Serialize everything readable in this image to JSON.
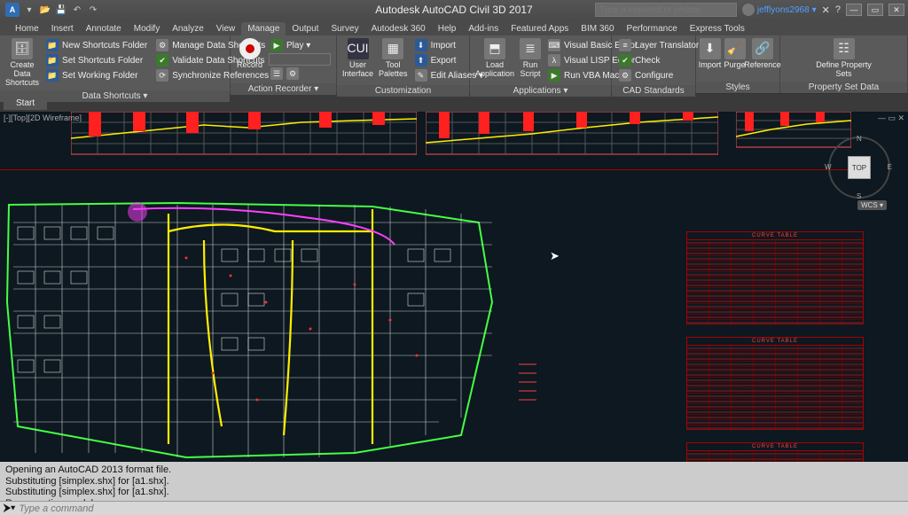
{
  "app_title": "Autodesk AutoCAD Civil 3D 2017",
  "search_placeholder": "Type a keyword or phrase",
  "user": "jefflyons2968",
  "ribbon_tabs": [
    "Home",
    "Insert",
    "Annotate",
    "Modify",
    "Analyze",
    "View",
    "Manage",
    "Output",
    "Survey",
    "Autodesk 360",
    "Help",
    "Add-ins",
    "Featured Apps",
    "BIM 360",
    "Performance",
    "Express Tools"
  ],
  "ribbon_active": "Manage",
  "panels": {
    "data_shortcuts": {
      "title": "Data Shortcuts ▾",
      "big": "Create Data\nShortcuts",
      "items": [
        "New Shortcuts Folder",
        "Set Shortcuts Folder",
        "Set Working Folder",
        "Manage Data Shortcuts",
        "Validate Data Shortcuts",
        "Synchronize References"
      ]
    },
    "action_recorder": {
      "title": "Action Recorder ▾",
      "big": "Record",
      "items": [
        "Play  ▾"
      ]
    },
    "customization": {
      "title": "Customization",
      "big1": "User\nInterface",
      "big2": "Tool\nPalettes",
      "items": [
        "Import",
        "Export",
        "Edit Aliases ▾"
      ]
    },
    "applications": {
      "title": "Applications ▾",
      "big1": "Load\nApplication",
      "big2": "Run\nScript",
      "items": [
        "Visual Basic Editor",
        "Visual LISP Editor",
        "Run VBA Macro"
      ]
    },
    "cad_standards": {
      "title": "CAD Standards",
      "items": [
        "Layer Translator",
        "Check",
        "Configure"
      ]
    },
    "styles": {
      "title": "Styles",
      "big1": "Import",
      "big2": "Purge",
      "big3": "Reference"
    },
    "psd": {
      "title": "Property Set Data",
      "big": "Define Property Sets"
    }
  },
  "doc_tab": "Start",
  "viewport_label": "[-][Top][2D Wireframe]",
  "navcube": {
    "face": "TOP",
    "n": "N",
    "s": "S",
    "e": "E",
    "w": "W"
  },
  "wcs": "WCS ▾",
  "table_headings": [
    "CURVE TABLE",
    "CURVE TABLE",
    "CURVE TABLE"
  ],
  "cmd_history": [
    "Opening an AutoCAD 2013 format file.",
    "Substituting [simplex.shx] for [a1.shx].",
    "Substituting [simplex.shx] for [a1.shx].",
    "Regenerating model."
  ],
  "cmd_prompt": "⮞▾",
  "cmd_placeholder": "Type a command"
}
